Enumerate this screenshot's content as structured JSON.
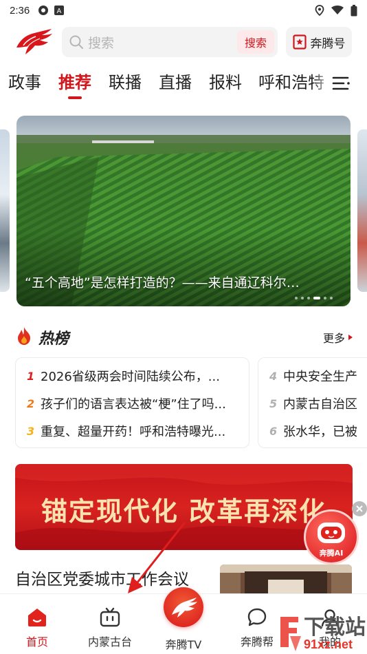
{
  "status_bar": {
    "time": "2:36",
    "left_icons": [
      "settings-icon",
      "notification-a-icon"
    ],
    "right_icons": [
      "location-icon",
      "wifi-icon",
      "battery-icon"
    ]
  },
  "header": {
    "logo": "benteng-horse-logo",
    "search_placeholder": "搜索",
    "search_button": "搜索",
    "benteng_label": "奔腾号"
  },
  "tabs": [
    {
      "label": "政事",
      "active": false
    },
    {
      "label": "推荐",
      "active": true
    },
    {
      "label": "联播",
      "active": false
    },
    {
      "label": "直播",
      "active": false
    },
    {
      "label": "报料",
      "active": false
    },
    {
      "label": "呼和浩特",
      "active": false
    }
  ],
  "banner": {
    "title": "“五个高地”是怎样打造的？——来自通辽科尔…",
    "dots_total": 6,
    "dots_active_index": 3
  },
  "hot": {
    "title": "热榜",
    "more": "更多",
    "left_items": [
      {
        "rank": "1",
        "text": "2026省级两会时间陆续公布，..."
      },
      {
        "rank": "2",
        "text": "孩子们的语言表达被“梗”住了吗..."
      },
      {
        "rank": "3",
        "text": "重复、超量开药！呼和浩特曝光..."
      }
    ],
    "right_items": [
      {
        "rank": "4",
        "text": "中央安全生产"
      },
      {
        "rank": "5",
        "text": "内蒙古自治区"
      },
      {
        "rank": "6",
        "text": "张水华，已被"
      }
    ],
    "rank_colors": {
      "1": "#e02020",
      "2": "#f07a1a",
      "3": "#f5b21a",
      "other": "#b0b0b0"
    }
  },
  "promo_banner": {
    "text": "锚定现代化  改革再深化"
  },
  "ai_assistant": {
    "label": "奔腾AI"
  },
  "news": {
    "title": "自治区党委城市工作会议"
  },
  "bottom_nav": [
    {
      "label": "首页",
      "active": true
    },
    {
      "label": "内蒙古台",
      "active": false
    },
    {
      "label": "奔腾TV",
      "active": false
    },
    {
      "label": "奔腾帮",
      "active": false
    },
    {
      "label": "我的",
      "active": false
    }
  ],
  "watermark": {
    "line1": "下载站",
    "line2": "91xz.net"
  },
  "colors": {
    "accent": "#d1161c",
    "search_bg": "#f3f3f3"
  }
}
